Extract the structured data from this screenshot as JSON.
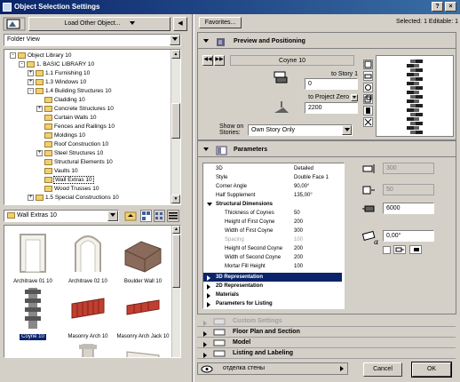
{
  "window": {
    "title": "Object Selection Settings",
    "controls": [
      "?",
      "×"
    ]
  },
  "left": {
    "load_button": "Load Other Object...",
    "view_select": "Folder View",
    "tree": [
      {
        "label": "Object Library 10",
        "level": 0,
        "exp": "-",
        "sel": false
      },
      {
        "label": "1. BASIC LIBRARY 10",
        "level": 1,
        "exp": "-",
        "sel": false
      },
      {
        "label": "1.1 Furnishing 10",
        "level": 2,
        "exp": "+",
        "sel": false
      },
      {
        "label": "1.3 Windows 10",
        "level": 2,
        "exp": "+",
        "sel": false
      },
      {
        "label": "1.4 Building Structures 10",
        "level": 2,
        "exp": "-",
        "sel": false
      },
      {
        "label": "Cladding 10",
        "level": 3,
        "exp": "",
        "sel": false
      },
      {
        "label": "Concrete Structures 10",
        "level": 3,
        "exp": "+",
        "sel": false
      },
      {
        "label": "Curtain Walls 10",
        "level": 3,
        "exp": "",
        "sel": false
      },
      {
        "label": "Fences and Railings 10",
        "level": 3,
        "exp": "",
        "sel": false
      },
      {
        "label": "Moldings 10",
        "level": 3,
        "exp": "",
        "sel": false
      },
      {
        "label": "Roof Construction 10",
        "level": 3,
        "exp": "",
        "sel": false
      },
      {
        "label": "Steel Structures 10",
        "level": 3,
        "exp": "+",
        "sel": false
      },
      {
        "label": "Structural Elements 10",
        "level": 3,
        "exp": "",
        "sel": false
      },
      {
        "label": "Vaults 10",
        "level": 3,
        "exp": "",
        "sel": false
      },
      {
        "label": "Wall Extras 10",
        "level": 3,
        "exp": "",
        "sel": true
      },
      {
        "label": "Wood Trusses 10",
        "level": 3,
        "exp": "",
        "sel": false
      },
      {
        "label": "1.5 Special Constructions 10",
        "level": 2,
        "exp": "+",
        "sel": false
      }
    ],
    "folder_select": "Wall Extras 10",
    "thumbs": [
      {
        "label": "Architrave 01 10",
        "kind": "arch1"
      },
      {
        "label": "Architrave 02 10",
        "kind": "arch2"
      },
      {
        "label": "Boulder Wall 10",
        "kind": "boulder"
      },
      {
        "label": "Coyne 10",
        "kind": "coyne",
        "sel": true
      },
      {
        "label": "Masonry Arch 10",
        "kind": "brick"
      },
      {
        "label": "Masonry Arch Jack 10",
        "kind": "jack"
      },
      {
        "label": "",
        "kind": "arc"
      },
      {
        "label": "",
        "kind": "column"
      },
      {
        "label": "",
        "kind": "panel"
      }
    ]
  },
  "right": {
    "favorites": "Favorites...",
    "selected": "Selected: 1 Editable: 1",
    "preview_title": "Preview and Positioning",
    "object_name": "Coyne 10",
    "to_story": "to Story 1",
    "to_story_val": "0",
    "to_project_zero": "to Project Zero",
    "project_zero_val": "2200",
    "show_on_stories_label": "Show on Stories:",
    "show_on_stories_val": "Own Story Only",
    "params_title": "Parameters",
    "params": [
      {
        "k": "3D",
        "v": "Detailed",
        "t": "n"
      },
      {
        "k": "Style",
        "v": "Double Face 1",
        "t": "n"
      },
      {
        "k": "Corner Angle",
        "v": "90,00°",
        "t": "n"
      },
      {
        "k": "Half Supplement",
        "v": "135,00°",
        "t": "n"
      },
      {
        "k": "Structural Dimensions",
        "v": "",
        "t": "h"
      },
      {
        "k": "Thickness of Coynes",
        "v": "50",
        "t": "i"
      },
      {
        "k": "Height of First Coyne",
        "v": "200",
        "t": "i"
      },
      {
        "k": "Width of First Coyne",
        "v": "300",
        "t": "i"
      },
      {
        "k": "Spacing",
        "v": "100",
        "t": "d"
      },
      {
        "k": "Height of Second Coyne",
        "v": "200",
        "t": "i"
      },
      {
        "k": "Width of Second Coyne",
        "v": "200",
        "t": "i"
      },
      {
        "k": "Mortar Fill Height",
        "v": "100",
        "t": "i"
      }
    ],
    "groups": [
      "3D Representation",
      "2D Representation",
      "Materials",
      "Parameters for Listing"
    ],
    "side_vals": [
      "300",
      "50",
      "6000",
      "0,00°"
    ],
    "sections": [
      {
        "label": "Custom Settings",
        "dis": true
      },
      {
        "label": "Floor Plan and Section",
        "dis": false
      },
      {
        "label": "Model",
        "dis": false
      },
      {
        "label": "Listing and Labeling",
        "dis": false
      }
    ],
    "layer": "отделка стены",
    "cancel": "Cancel",
    "ok": "OK"
  },
  "colors": {
    "select": "#0a246a",
    "title_a": "#0a246a",
    "title_b": "#3a6ea5"
  }
}
